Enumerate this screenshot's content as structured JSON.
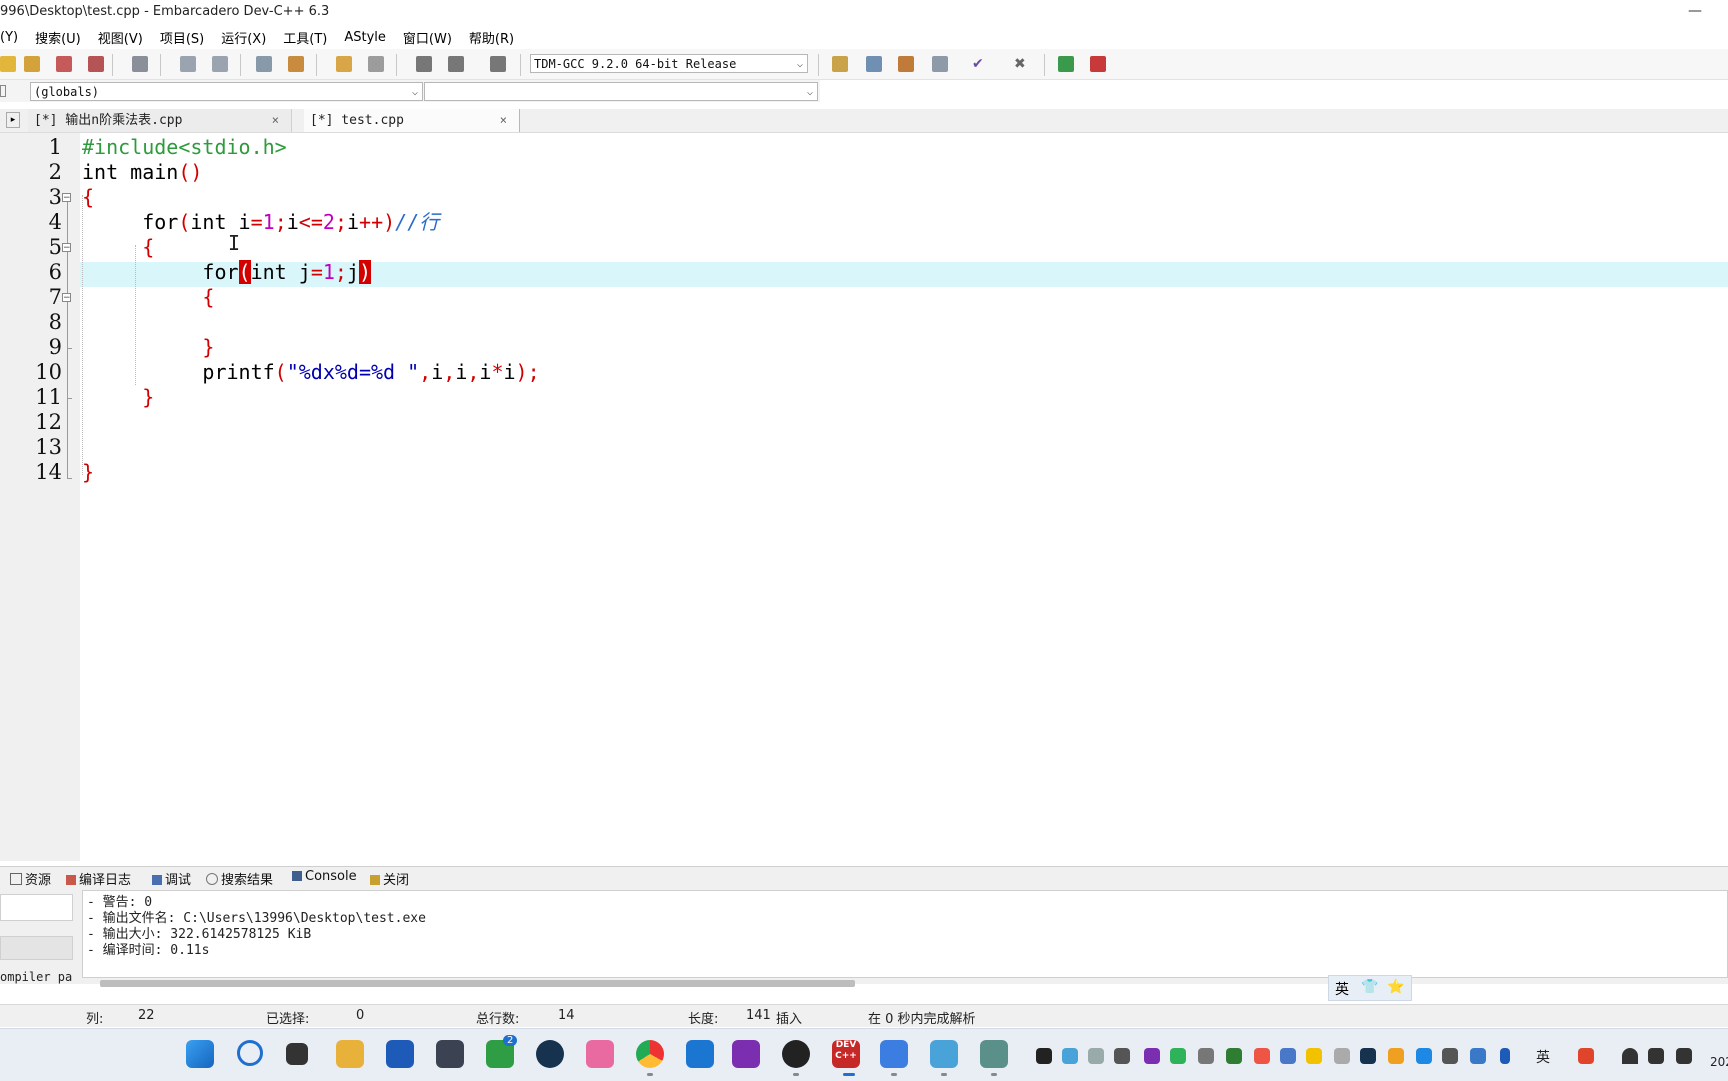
{
  "window": {
    "title": "996\\Desktop\\test.cpp - Embarcadero Dev-C++ 6.3",
    "minimize_glyph": "—"
  },
  "menu": {
    "items": [
      "(Y)",
      "搜索(U)",
      "视图(V)",
      "项目(S)",
      "运行(X)",
      "工具(T)",
      "AStyle",
      "窗口(W)",
      "帮助(R)"
    ]
  },
  "toolbar": {
    "compiler_select": "TDM-GCC 9.2.0 64-bit Release"
  },
  "classbar": {
    "scope_select": "(globals)",
    "member_select": ""
  },
  "tabs": [
    {
      "label": "[*] 输出n阶乘法表.cpp",
      "close": "×"
    },
    {
      "label": "[*] test.cpp",
      "close": "×"
    }
  ],
  "editor": {
    "line_numbers": [
      "1",
      "2",
      "3",
      "4",
      "5",
      "6",
      "7",
      "8",
      "9",
      "10",
      "11",
      "12",
      "13",
      "14"
    ],
    "code": {
      "l1": {
        "a": "#include<stdio.h>"
      },
      "l2": {
        "a": "int main",
        "b": "()"
      },
      "l3": {
        "a": "{"
      },
      "l4": {
        "a": "for",
        "b": "(",
        "c": "int i",
        "d": "=",
        "e": "1",
        "f": ";",
        "g": "i",
        "h": "<=",
        "i": "2",
        "j": ";",
        "k": "i",
        "l": "++)",
        "m": "//行"
      },
      "l5": {
        "a": "{"
      },
      "l6": {
        "a": "for",
        "b": "(",
        "c": "int j",
        "d": "=",
        "e": "1",
        "f": ";",
        "g": "j",
        "h": ")"
      },
      "l7": {
        "a": "{"
      },
      "l9": {
        "a": "}"
      },
      "l10": {
        "a": "printf",
        "b": "(",
        "c": "\"%dx%d=%d \"",
        "d": ",",
        "e": "i",
        "f": ",",
        "g": "i",
        "h": ",",
        "i": "i",
        "j": "*",
        "k": "i",
        "l": ");"
      },
      "l11": {
        "a": "}"
      },
      "l14": {
        "a": "}"
      }
    },
    "fold_marker": "−"
  },
  "panel": {
    "tabs": [
      "资源",
      "编译日志",
      "调试",
      "搜索结果",
      "Console",
      "关闭"
    ],
    "left_label": "ompiler pa",
    "log": [
      "- 警告: 0",
      "- 输出文件名: C:\\Users\\13996\\Desktop\\test.exe",
      "- 输出大小: 322.6142578125 KiB",
      "- 编译时间: 0.11s"
    ]
  },
  "ime": {
    "lang": "英",
    "shirt": "👕",
    "star": "⭐"
  },
  "status": {
    "col_label": "列:",
    "col_value": "22",
    "sel_label": "已选择:",
    "sel_value": "0",
    "lines_label": "总行数:",
    "lines_value": "14",
    "len_label": "长度:",
    "len_value": "141",
    "mode": "插入",
    "parse": "在 0 秒内完成解析"
  },
  "taskbar": {
    "xbox_badge": "2",
    "dev_label": "DEV\nC++",
    "tray_lang": "英",
    "clock_fragment": "202"
  },
  "colors": {
    "active_line": "#d9f7fb",
    "bracket_highlight": "#d40000",
    "preprocessor": "#2d9b3b",
    "string": "#0000b0",
    "comment": "#2a6cc8"
  }
}
